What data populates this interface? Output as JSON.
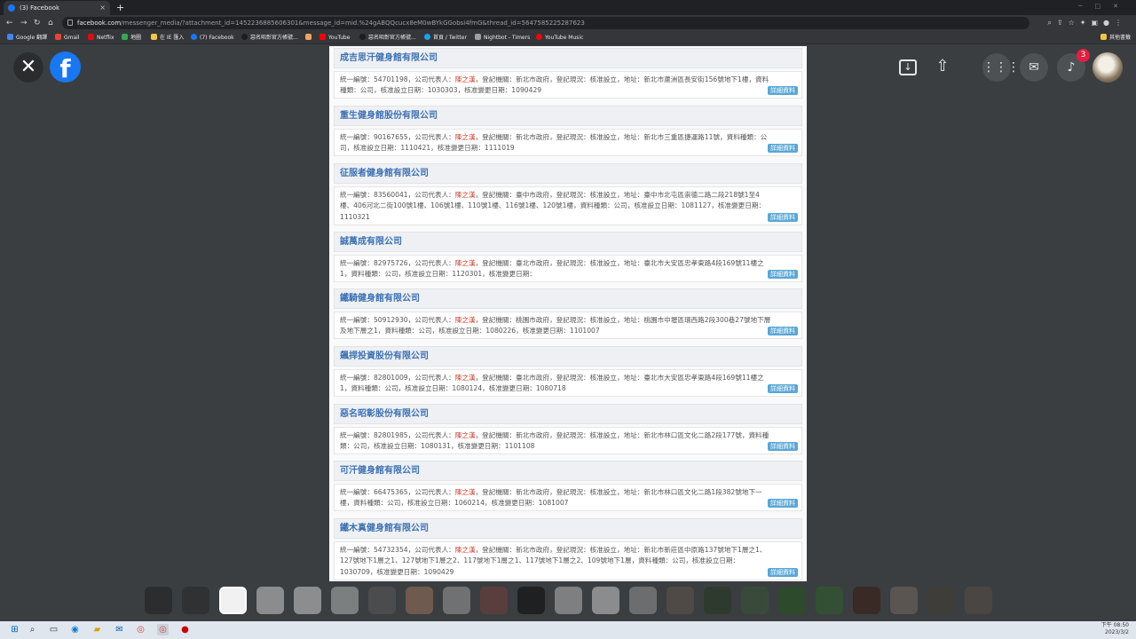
{
  "browser": {
    "tab_title": "(3) Facebook",
    "tab_close": "×",
    "new_tab": "+",
    "url_domain": "facebook.com",
    "url_path": "/messenger_media/?attachment_id=1452236885606301&message_id=mid.%24gABQQcucx8eM0wBYkGGobsi4fmG&thread_id=5647585225287623",
    "bookmarks": [
      "Google 翻譯",
      "Gmail",
      "Netflix",
      "地圖",
      "在 IE 匯入",
      "(7) Facebook",
      "惡名昭彰官方帳號...",
      "YouTube",
      "惡名昭彰官方帳號...",
      "首頁 / Twitter",
      "Nightbot - Timers",
      "YouTube Music"
    ],
    "other_bookmarks": "其他書籤"
  },
  "viewer": {
    "close_glyph": "✕",
    "logo_letter": "f",
    "notification_count": "3"
  },
  "document": {
    "details_label": "詳細資料",
    "entries": [
      {
        "title": "成吉思汗健身館有限公司",
        "pre": "統一編號：54701198，公司代表人：",
        "rep": "陳之漢",
        "post": "，登記機關：新北市政府，登記現況：核准設立，地址：新北市蘆洲區長安街156號地下1樓，資料種類：公司，核准設立日期：1030303，核准變更日期：1090429"
      },
      {
        "title": "重生健身館股份有限公司",
        "pre": "統一編號：90167655，公司代表人：",
        "rep": "陳之漢",
        "post": "，登記機關：新北市政府，登記現況：核准設立，地址：新北市三重區捷運路11號，資料種類：公司，核准設立日期：1110421，核准變更日期：1111019"
      },
      {
        "title": "征服者健身館有限公司",
        "pre": "統一編號：83560041，公司代表人：",
        "rep": "陳之漢",
        "post": "，登記機關：臺中市政府，登記現況：核准設立，地址：臺中市北屯區崇德二路二段218號1至4樓、406河北二街100號1樓、106號1樓、110號1樓、116號1樓、120號1樓，資料種類：公司，核准設立日期：1081127，核准變更日期：1110321"
      },
      {
        "title": "誠萬成有限公司",
        "pre": "統一編號：82975726，公司代表人：",
        "rep": "陳之漢",
        "post": "，登記機關：臺北市政府，登記現況：核准設立，地址：臺北市大安區忠孝東路4段169號11樓之1，資料種類：公司，核准設立日期：1120301，核准變更日期："
      },
      {
        "title": "鐵騎健身館有限公司",
        "pre": "統一編號：50912930，公司代表人：",
        "rep": "陳之漢",
        "post": "，登記機關：桃園市政府，登記現況：核准設立，地址：桃園市中壢區環西路2段300巷27號地下層及地下層之1，資料種類：公司，核准設立日期：1080226，核准變更日期：1101007"
      },
      {
        "title": "飆捍投資股份有限公司",
        "pre": "統一編號：82801009，公司代表人：",
        "rep": "陳之漢",
        "post": "，登記機關：臺北市政府，登記現況：核准設立，地址：臺北市大安區忠孝東路4段169號11樓之1，資料種類：公司，核准設立日期：1080124，核准變更日期：1080718"
      },
      {
        "title": "惡名昭彰股份有限公司",
        "pre": "統一編號：82801985，公司代表人：",
        "rep": "陳之漢",
        "post": "，登記機關：新北市政府，登記現況：核准設立，地址：新北市林口區文化二路2段177號，資料種類：公司，核准設立日期：1080131，核准變更日期：1101108"
      },
      {
        "title": "可汗健身館有限公司",
        "pre": "統一編號：66475365，公司代表人：",
        "rep": "陳之漢",
        "post": "，登記機關：新北市政府，登記現況：核准設立，地址：新北市林口區文化二路1段382號地下一樓，資料種類：公司，核准設立日期：1060214，核准變更日期：1081007"
      },
      {
        "title": "鐵木真健身館有限公司",
        "pre": "統一編號：54732354，公司代表人：",
        "rep": "陳之漢",
        "post": "，登記機關：新北市政府，登記現況：核准設立，地址：新北市新莊區中原路137號地下1層之1、127號地下1層之1、127號地下1層之2、117號地下1層之1、117號地下1層之2、109號地下1層，資料種類：公司，核准設立日期：1030709，核准變更日期：1090429"
      }
    ]
  },
  "taskbar": {
    "time": "下午 08:50",
    "date": "2023/3/2"
  }
}
